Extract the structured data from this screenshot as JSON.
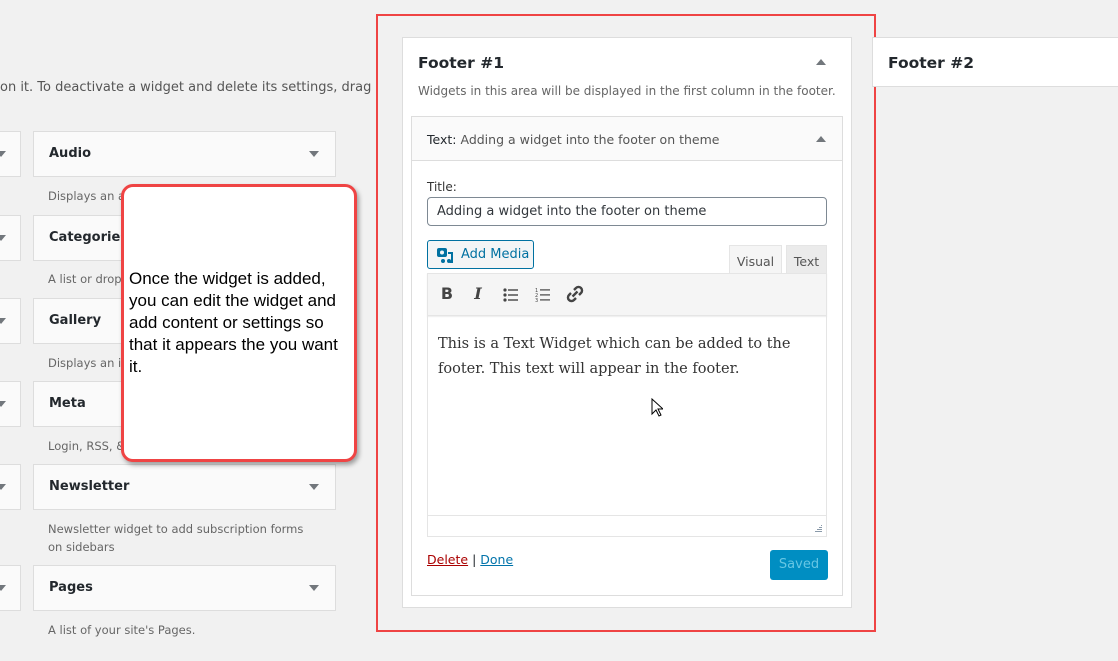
{
  "intro_text": "on it. To deactivate a widget and delete its settings, drag",
  "widgets": [
    {
      "name": "Audio",
      "desc": "Displays an au"
    },
    {
      "name": "Categories",
      "desc": "A list or dropo"
    },
    {
      "name": "Gallery",
      "desc": "Displays an im"
    },
    {
      "name": "Meta",
      "desc": "Login, RSS, &"
    },
    {
      "name": "Newsletter",
      "desc": "Newsletter widget to add subscription forms on sidebars"
    },
    {
      "name": "Pages",
      "desc": "A list of your site's Pages."
    }
  ],
  "callout": "Once the widget is added, you can edit the widget and add content or settings so that it appears the you want it.",
  "footer1": {
    "title": "Footer #1",
    "desc": "Widgets in this area will be displayed in the first column in the footer.",
    "widget": {
      "type_label": "Text:",
      "title": "Adding a widget into the footer on theme",
      "title_label": "Title:",
      "title_value": "Adding a widget into the footer on theme",
      "add_media": "Add Media",
      "tab_visual": "Visual",
      "tab_text": "Text",
      "content": "This is a Text Widget which can be added to the footer.  This text will appear in the footer.",
      "delete": "Delete",
      "separator": "|",
      "done": "Done",
      "saved": "Saved"
    }
  },
  "footer2": {
    "title": "Footer #2"
  },
  "colors": {
    "highlight": "#ef4444",
    "primary": "#008ec2",
    "delete": "#a00",
    "link": "#0073aa"
  }
}
